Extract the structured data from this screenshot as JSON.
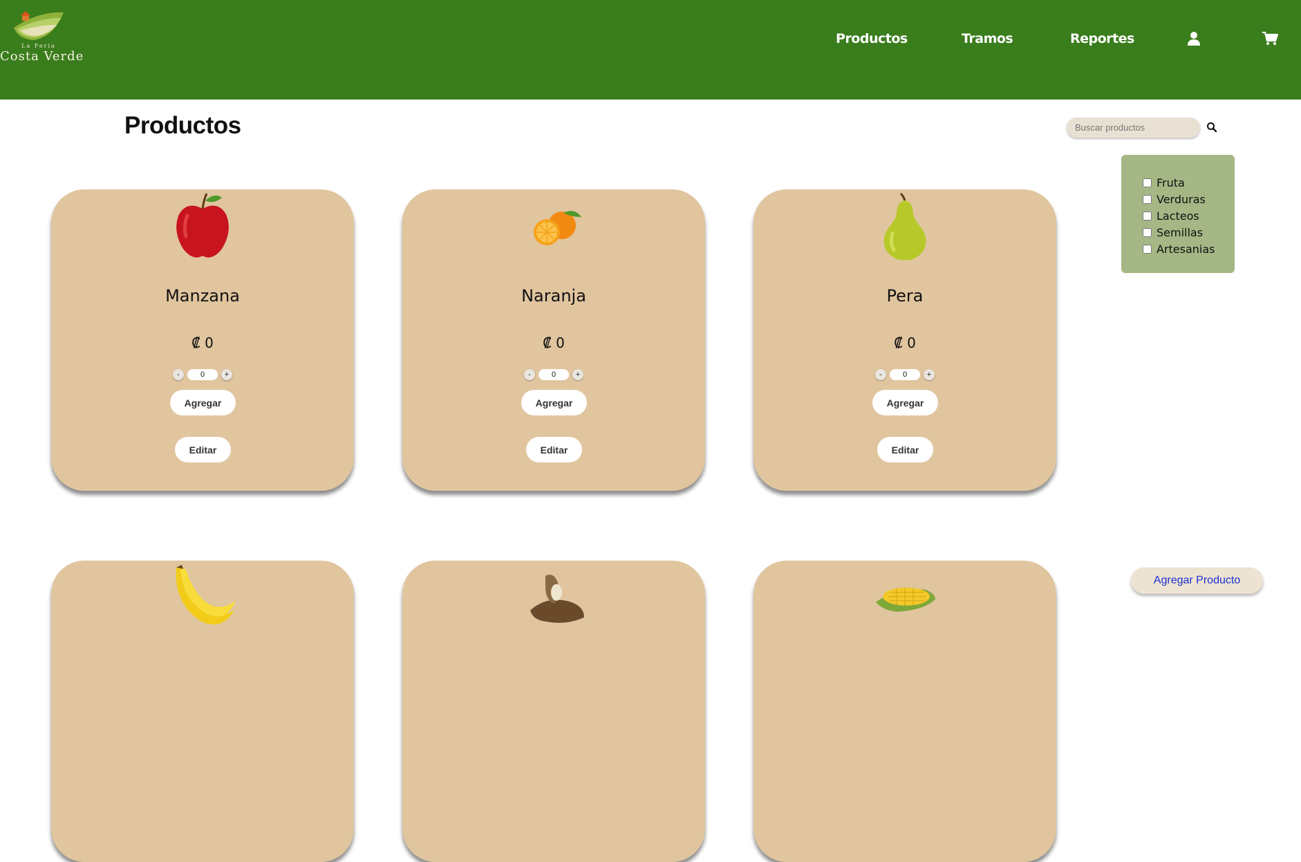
{
  "brand": {
    "small": "La Feria",
    "name": "Costa Verde"
  },
  "nav": {
    "productos": "Productos",
    "tramos": "Tramos",
    "reportes": "Reportes",
    "user_icon": "user-icon",
    "cart_icon": "cart-icon"
  },
  "page": {
    "title": "Productos"
  },
  "search": {
    "placeholder": "Buscar productos",
    "icon": "search-icon"
  },
  "filters": [
    "Fruta",
    "Verduras",
    "Lacteos",
    "Semillas",
    "Artesanias"
  ],
  "products": [
    {
      "name": "Manzana",
      "price": "₡ 0",
      "qty": "0",
      "image": "apple"
    },
    {
      "name": "Naranja",
      "price": "₡ 0",
      "qty": "0",
      "image": "orange"
    },
    {
      "name": "Pera",
      "price": "₡ 0",
      "qty": "0",
      "image": "pear"
    },
    {
      "name": "",
      "price": "",
      "qty": "",
      "image": "banana"
    },
    {
      "name": "",
      "price": "",
      "qty": "",
      "image": "yuca"
    },
    {
      "name": "",
      "price": "",
      "qty": "",
      "image": "corn"
    }
  ],
  "card_labels": {
    "minus": "-",
    "plus": "+",
    "add": "Agregar",
    "edit": "Editar"
  },
  "actions": {
    "add_product": "Agregar Producto"
  },
  "colors": {
    "header": "#3a7d1c",
    "card": "#e0c59f",
    "filter_panel": "#a5b784",
    "add_product_text": "#1e2fd0"
  }
}
